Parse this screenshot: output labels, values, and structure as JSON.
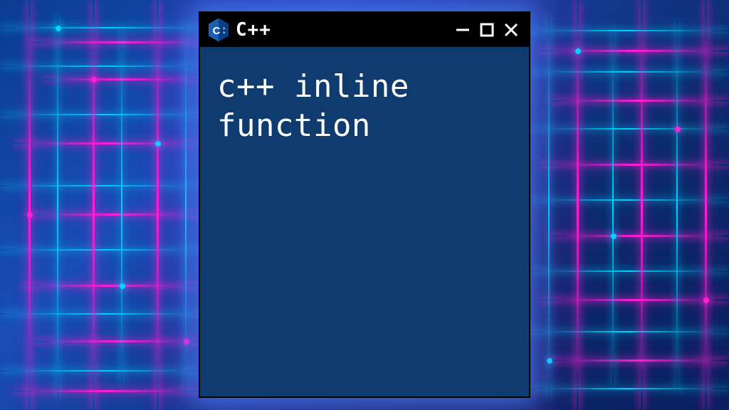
{
  "window": {
    "title": "C++",
    "icon": "cpp-logo-icon",
    "controls": {
      "minimize": "minimize-icon",
      "maximize": "maximize-icon",
      "close": "close-icon"
    }
  },
  "content": {
    "line1": "c++ inline",
    "line2": "function"
  },
  "colors": {
    "window_bg": "#0f3b6e",
    "titlebar_bg": "#000000",
    "text": "#ffffff",
    "accent_cyan": "#00d4ff",
    "accent_pink": "#ff1fd6",
    "cpp_blue": "#1a5fb4"
  }
}
